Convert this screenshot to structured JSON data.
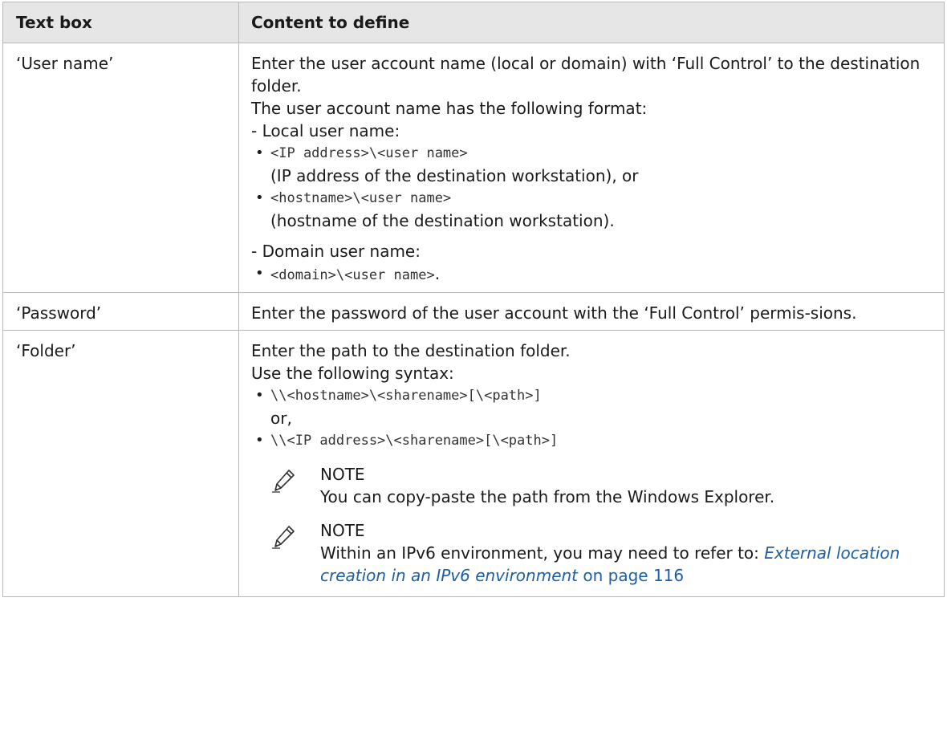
{
  "table": {
    "header": {
      "col1": "Text box",
      "col2": "Content to define"
    },
    "user": {
      "label": "‘User name’",
      "p1": "Enter the user account name (local or domain) with ‘Full Control’ to the destination folder.",
      "p2": "The user account name has the following format:",
      "local_heading": "- Local user name:",
      "local_items": [
        {
          "code": "<IP address>\\<user name>",
          "desc": "(IP address of the destination workstation), or"
        },
        {
          "code": "<hostname>\\<user name>",
          "desc": "(hostname of the destination workstation)."
        }
      ],
      "domain_heading": "- Domain user name:",
      "domain_item": {
        "code": "<domain>\\<user name>",
        "suffix": "."
      }
    },
    "password": {
      "label": "‘Password’",
      "text": "Enter the password of the user account with the ‘Full Control’ permis-sions."
    },
    "folder": {
      "label": "‘Folder’",
      "p1": "Enter the path to the destination folder.",
      "p2": "Use the following syntax:",
      "items": [
        {
          "code": "\\\\<hostname>\\<sharename>[\\<path>]",
          "desc": "or,"
        },
        {
          "code": "\\\\<IP address>\\<sharename>[\\<path>]"
        }
      ],
      "note1": {
        "title": "NOTE",
        "text": "You can copy-paste the path from the Windows Explorer."
      },
      "note2": {
        "title": "NOTE",
        "text": "Within an IPv6 environment, you may need to refer to: ",
        "link_text": "External location creation in an IPv6 environment",
        "link_suffix": " on page 116"
      }
    }
  },
  "icons": {
    "note": "pencil-note-icon"
  },
  "colors": {
    "header_bg": "#e6e6e6",
    "link": "#1c5fa8",
    "border": "#b8b8b8"
  }
}
